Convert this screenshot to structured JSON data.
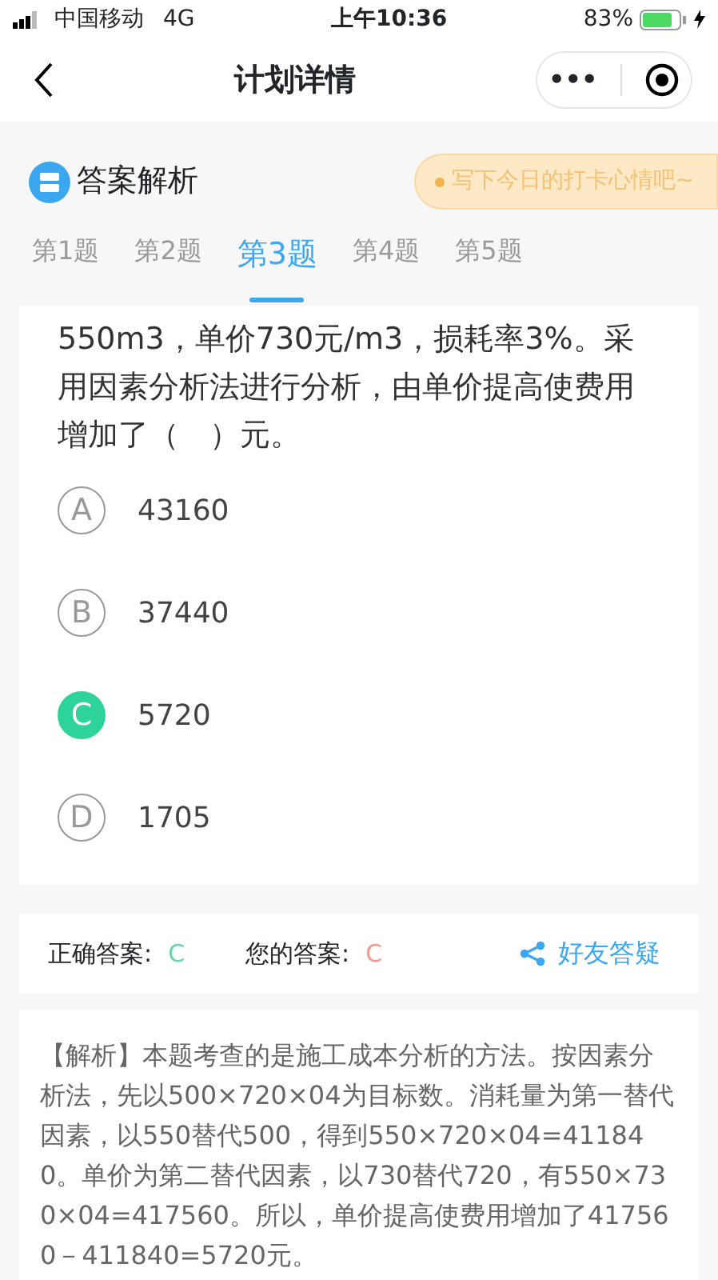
{
  "status_bar": {
    "carrier": "中国移动",
    "network": "4G",
    "time": "上午10:36",
    "battery_text": "83%"
  },
  "nav": {
    "title": "计划详情",
    "more": "•••"
  },
  "section": {
    "title": "答案解析",
    "mood_placeholder": "写下今日的打卡心情吧~"
  },
  "tabs": [
    {
      "label": "第1题",
      "selected": false
    },
    {
      "label": "第2题",
      "selected": false
    },
    {
      "label": "第3题",
      "selected": true
    },
    {
      "label": "第4题",
      "selected": false
    },
    {
      "label": "第5题",
      "selected": false
    }
  ],
  "question": {
    "text": "550m3，单价730元/m3，损耗率3%。采用因素分析法进行分析，由单价提高使费用增加了（　）元。"
  },
  "options": [
    {
      "letter": "A",
      "value": "43160",
      "selected": false
    },
    {
      "letter": "B",
      "value": "37440",
      "selected": false
    },
    {
      "letter": "C",
      "value": "5720",
      "selected": true
    },
    {
      "letter": "D",
      "value": "1705",
      "selected": false
    }
  ],
  "answer": {
    "correct_label": "正确答案:",
    "correct": "C",
    "yours_label": "您的答案:",
    "yours": "C",
    "ask_friends": "好友答疑"
  },
  "analysis": "【解析】本题考查的是施工成本分析的方法。按因素分析法，先以500×720×04为目标数。消耗量为第一替代因素，以550替代500，得到550×720×04=411840。单价为第二替代因素，以730替代720，有550×730×04=417560。所以，单价提高使费用增加了417560－411840=5720元。"
}
